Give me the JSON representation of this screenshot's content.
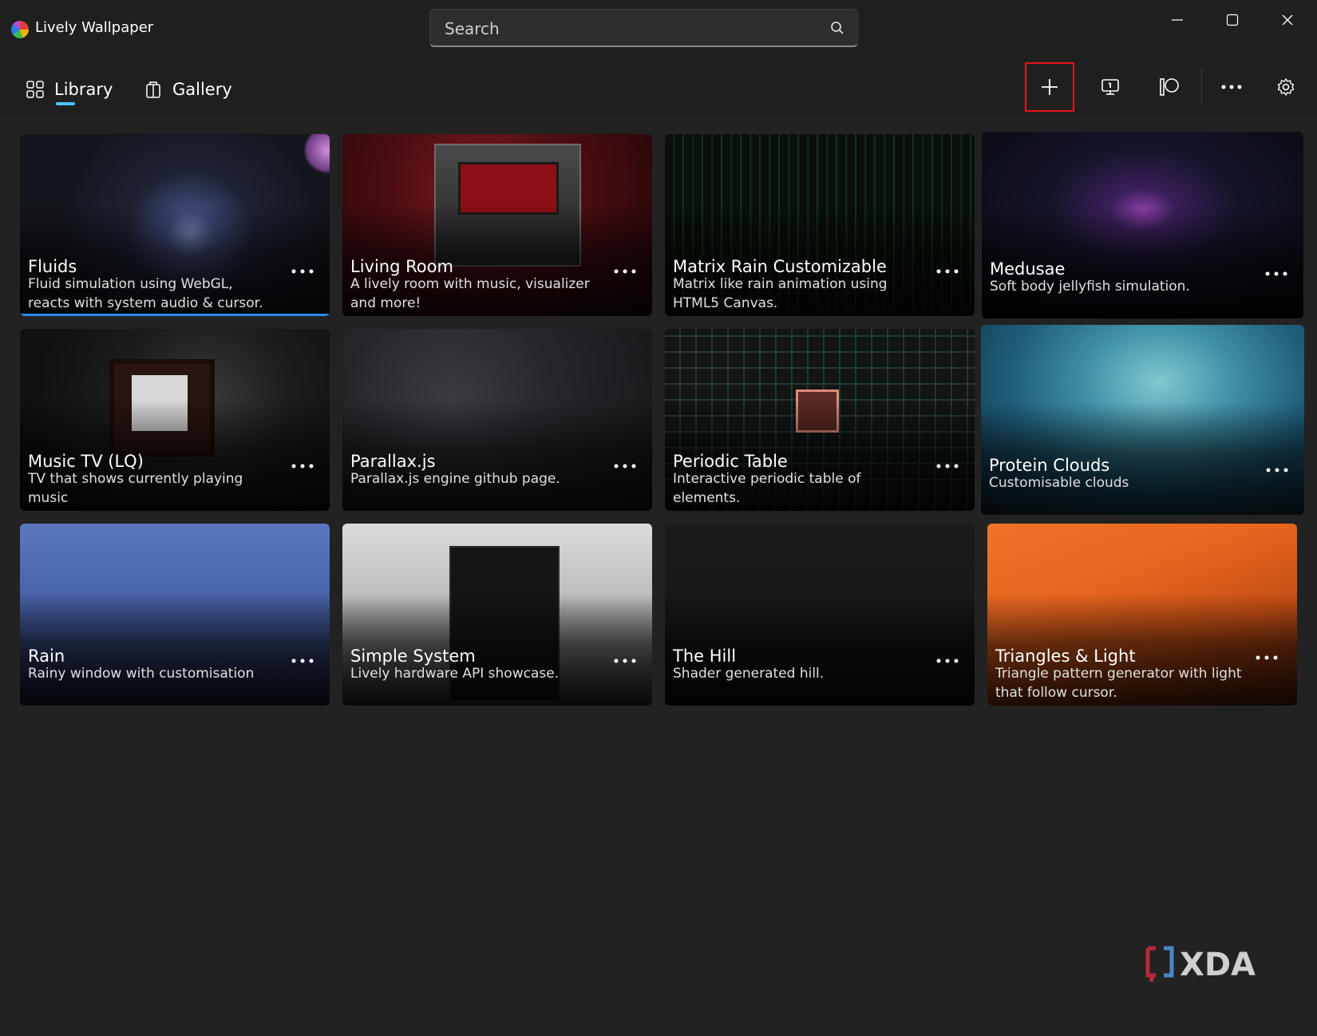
{
  "app": {
    "title": "Lively Wallpaper"
  },
  "search": {
    "placeholder": "Search"
  },
  "tabs": [
    {
      "label": "Library",
      "icon": "grid-icon",
      "active": true
    },
    {
      "label": "Gallery",
      "icon": "bag-icon",
      "active": false
    }
  ],
  "toolbar": {
    "buttons": [
      {
        "name": "add-wallpaper-button",
        "icon": "plus-icon",
        "highlighted": true
      },
      {
        "name": "display-button",
        "icon": "monitor-icon"
      },
      {
        "name": "patreon-button",
        "icon": "patreon-icon"
      },
      {
        "name": "more-button",
        "icon": "more-horizontal-icon"
      },
      {
        "name": "settings-button",
        "icon": "gear-icon"
      }
    ]
  },
  "wallpapers": [
    {
      "title": "Fluids",
      "description": "Fluid simulation using WebGL, reacts with system audio & cursor.",
      "selected": true
    },
    {
      "title": "Living Room",
      "description": "A lively room with music, visualizer and more!"
    },
    {
      "title": "Matrix Rain Customizable",
      "description": "Matrix like rain animation using HTML5 Canvas."
    },
    {
      "title": "Medusae",
      "description": "Soft body jellyfish simulation."
    },
    {
      "title": "Music TV (LQ)",
      "description": "TV that shows currently playing music"
    },
    {
      "title": "Parallax.js",
      "description": "Parallax.js engine github page."
    },
    {
      "title": "Periodic Table",
      "description": "Interactive periodic table of elements."
    },
    {
      "title": "Protein Clouds",
      "description": "Customisable clouds"
    },
    {
      "title": "Rain",
      "description": "Rainy window with customisation"
    },
    {
      "title": "Simple System",
      "description": "Lively hardware API showcase."
    },
    {
      "title": "The Hill",
      "description": "Shader generated hill."
    },
    {
      "title": "Triangles & Light",
      "description": "Triangle pattern generator with light that follow cursor."
    }
  ],
  "colors": {
    "accent": "#4cc2ff",
    "highlight": "#e8141a",
    "selection": "#2b8be6"
  },
  "watermark": {
    "text": "XDA"
  }
}
